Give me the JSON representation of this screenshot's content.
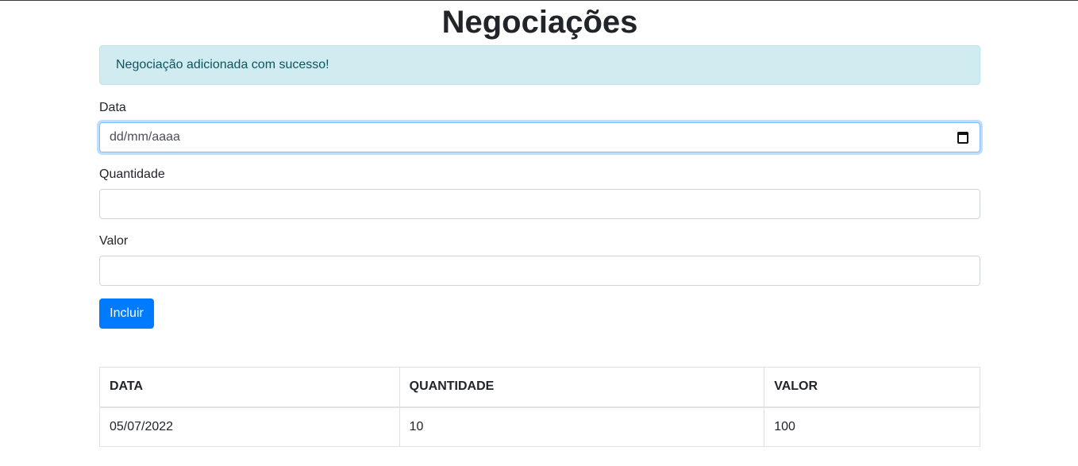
{
  "page": {
    "title": "Negociações"
  },
  "alert": {
    "message": "Negociação adicionada com sucesso!"
  },
  "form": {
    "data": {
      "label": "Data",
      "placeholder": "dd/mm/aaaa",
      "icon": "calendar-icon"
    },
    "quantidade": {
      "label": "Quantidade",
      "value": ""
    },
    "valor": {
      "label": "Valor",
      "value": ""
    },
    "submit_label": "Incluir"
  },
  "table": {
    "headers": [
      "DATA",
      "QUANTIDADE",
      "VALOR"
    ],
    "rows": [
      [
        "05/07/2022",
        "10",
        "100"
      ]
    ]
  },
  "colors": {
    "primary": "#007bff",
    "alert_bg": "#d1ecf1",
    "alert_text": "#0c5460"
  }
}
